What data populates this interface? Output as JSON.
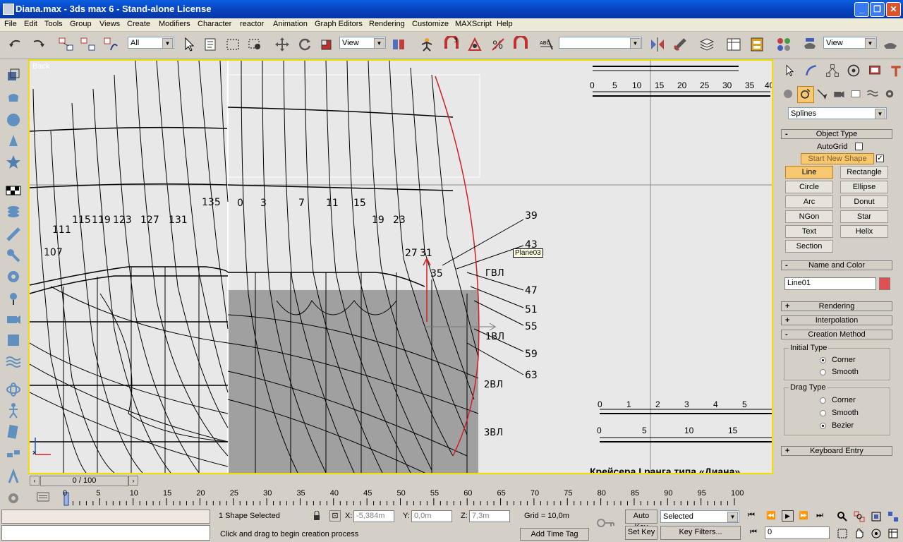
{
  "window": {
    "title": "Diana.max - 3ds max 6 - Stand-alone License",
    "min": "_",
    "max": "❐",
    "close": "✕"
  },
  "menu": [
    "File",
    "Edit",
    "Tools",
    "Group",
    "Views",
    "Create",
    "Modifiers",
    "Character",
    "reactor",
    "Animation",
    "Graph Editors",
    "Rendering",
    "Customize",
    "MAXScript",
    "Help"
  ],
  "toolbar": {
    "selection_filter": "All",
    "ref_coord": "View",
    "named_sel": "",
    "ref_coord2": "View",
    "snap_angle": "3",
    "snap_pct": "%"
  },
  "viewport": {
    "label": "Back",
    "tooltip": "Plane03",
    "station_numbers_top": [
      "135",
      "0",
      "3",
      "7",
      "11",
      "15",
      "19",
      "23",
      "27",
      "31"
    ],
    "station_numbers_left": [
      "111",
      "115",
      "119",
      "123",
      "127",
      "131",
      "107"
    ],
    "right_numbers": [
      "39",
      "43",
      "47",
      "51",
      "55",
      "59",
      "63",
      "35"
    ],
    "waterlines": [
      "ГВЛ",
      "1ВЛ",
      "2ВЛ",
      "3ВЛ"
    ],
    "scale1": [
      "0",
      "5",
      "10",
      "15",
      "20",
      "25",
      "30",
      "35",
      "40"
    ],
    "scale2a": [
      "0",
      "1",
      "2",
      "3",
      "4",
      "5"
    ],
    "scale2b": [
      "0",
      "5",
      "10",
      "15"
    ],
    "caption": "Крейсера I ранга типа «Диана»"
  },
  "cmdpanel": {
    "category": "Splines",
    "object_type": "Object Type",
    "autogrid": "AutoGrid",
    "start_new_shape": "Start New Shape",
    "buttons": [
      "Line",
      "Rectangle",
      "Circle",
      "Ellipse",
      "Arc",
      "Donut",
      "NGon",
      "Star",
      "Text",
      "Helix",
      "Section"
    ],
    "name_and_color": "Name and Color",
    "object_name": "Line01",
    "object_color": "#e05050",
    "rendering": "Rendering",
    "interpolation": "Interpolation",
    "creation_method": "Creation Method",
    "initial_type": "Initial Type",
    "initial_opts": [
      "Corner",
      "Smooth"
    ],
    "drag_type": "Drag Type",
    "drag_opts": [
      "Corner",
      "Smooth",
      "Bezier"
    ],
    "keyboard_entry": "Keyboard Entry"
  },
  "timeline": {
    "frame": "0 / 100",
    "ticks": [
      "0",
      "5",
      "10",
      "15",
      "20",
      "25",
      "30",
      "35",
      "40",
      "45",
      "50",
      "55",
      "60",
      "65",
      "70",
      "75",
      "80",
      "85",
      "90",
      "95",
      "100"
    ]
  },
  "status": {
    "selected": "1 Shape Selected",
    "prompt": "Click and drag to begin creation process",
    "x_label": "X:",
    "x": "-5,384m",
    "y_label": "Y:",
    "y": "0,0m",
    "z_label": "Z:",
    "z": "7,3m",
    "grid": "Grid = 10,0m",
    "add_time_tag": "Add Time Tag",
    "auto_key": "Auto Key",
    "set_key": "Set Key",
    "key_mode": "Selected",
    "key_filters": "Key Filters...",
    "current_frame": "0"
  }
}
